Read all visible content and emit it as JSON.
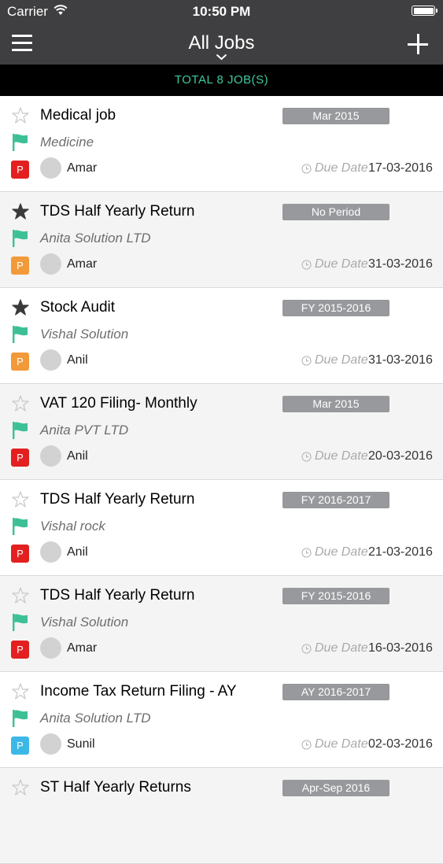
{
  "status_bar": {
    "carrier": "Carrier",
    "time": "10:50 PM"
  },
  "nav": {
    "title": "All Jobs"
  },
  "summary": {
    "total": "TOTAL 8 JOB(S)"
  },
  "colors": {
    "accent": "#40c9a2",
    "flag": "#3dbf98",
    "priority_red": "#e32020",
    "priority_orange": "#f29a3a",
    "priority_blue": "#3cb8e6"
  },
  "due_label": "Due Date",
  "jobs": [
    {
      "name": "Medical job",
      "client": "Medicine",
      "period": "Mar 2015",
      "assignee": "Amar",
      "due_date": "17-03-2016",
      "starred": false,
      "priority": "P",
      "priority_color": "#e32020"
    },
    {
      "name": "TDS Half Yearly Return",
      "client": "Anita Solution LTD",
      "period": "No Period",
      "assignee": "Amar",
      "due_date": "31-03-2016",
      "starred": true,
      "priority": "P",
      "priority_color": "#f29a3a"
    },
    {
      "name": "Stock Audit",
      "client": "Vishal Solution",
      "period": "FY 2015-2016",
      "assignee": "Anil",
      "due_date": "31-03-2016",
      "starred": true,
      "priority": "P",
      "priority_color": "#f29a3a"
    },
    {
      "name": "VAT 120 Filing- Monthly",
      "client": "Anita PVT LTD",
      "period": "Mar 2015",
      "assignee": "Anil",
      "due_date": "20-03-2016",
      "starred": false,
      "priority": "P",
      "priority_color": "#e32020"
    },
    {
      "name": "TDS Half Yearly Return",
      "client": "Vishal rock",
      "period": "FY 2016-2017",
      "assignee": "Anil",
      "due_date": "21-03-2016",
      "starred": false,
      "priority": "P",
      "priority_color": "#e32020"
    },
    {
      "name": "TDS Half Yearly Return",
      "client": "Vishal Solution",
      "period": "FY 2015-2016",
      "assignee": "Amar",
      "due_date": "16-03-2016",
      "starred": false,
      "priority": "P",
      "priority_color": "#e32020"
    },
    {
      "name": "Income Tax Return Filing - AY",
      "client": "Anita Solution LTD",
      "period": "AY 2016-2017",
      "assignee": "Sunil",
      "due_date": "02-03-2016",
      "starred": false,
      "priority": "P",
      "priority_color": "#3cb8e6"
    },
    {
      "name": "ST Half Yearly Returns",
      "client": "",
      "period": "Apr-Sep 2016",
      "assignee": "",
      "due_date": "",
      "starred": false,
      "priority": "",
      "priority_color": ""
    }
  ]
}
